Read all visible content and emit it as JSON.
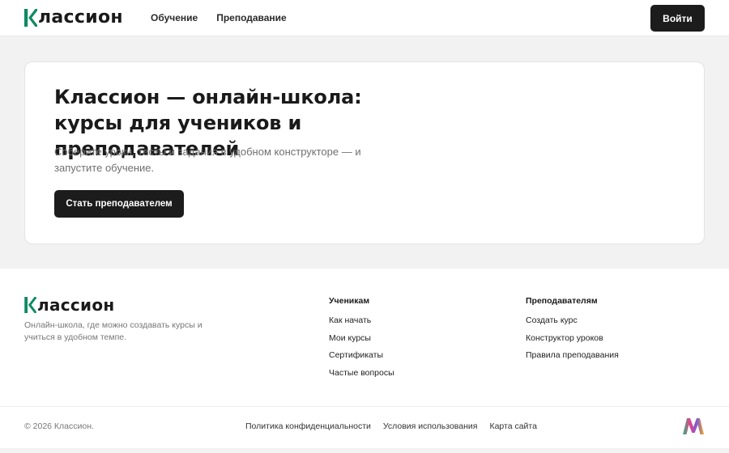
{
  "header": {
    "logo_text": "лассион",
    "nav": [
      {
        "label": "Обучение"
      },
      {
        "label": "Преподавание"
      }
    ],
    "login_label": "Войти"
  },
  "hero": {
    "title": "Классион — онлайн-школа: курсы для учеников и преподавателей",
    "subtitle": "Соберите уроки, тесты и задания в удобном конструкторе — и запустите обучение.",
    "cta_label": "Стать преподавателем"
  },
  "footer": {
    "logo_text": "лассион",
    "description": "Онлайн-школа, где можно создавать курсы и учиться в удобном темпе.",
    "students": {
      "title": "Ученикам",
      "links": [
        "Как начать",
        "Мои курсы",
        "Сертификаты",
        "Частые вопросы"
      ]
    },
    "teachers": {
      "title": "Преподавателям",
      "links": [
        "Создать курс",
        "Конструктор уроков",
        "Правила преподавания"
      ]
    },
    "copyright": "© 2026 Классион.",
    "legal": [
      "Политика конфиденциальности",
      "Условия использования",
      "Карта сайта"
    ]
  },
  "colors": {
    "brand_green": "#0f8a5f",
    "button_dark": "#1c1c1c",
    "page_bg": "#f2f2f2"
  },
  "icons": {
    "logo_mark": "k-letter-logo-icon",
    "brand_mark": "multicolor-m-logo-icon"
  }
}
